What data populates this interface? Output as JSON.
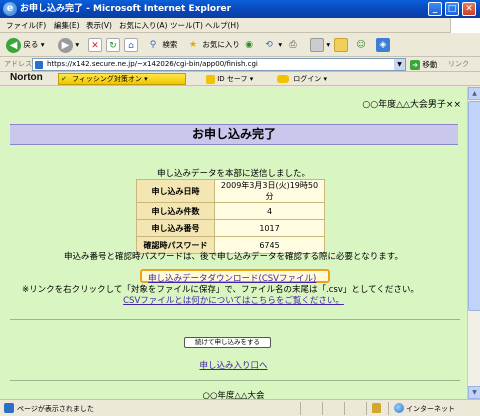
{
  "window": {
    "title": "お申し込み完了 - Microsoft Internet Explorer"
  },
  "menu": [
    "ファイル(F)",
    "編集(E)",
    "表示(V)",
    "お気に入り(A)",
    "ツール(T)",
    "ヘルプ(H)"
  ],
  "toolbar": {
    "back": "戻る",
    "search": "検索",
    "favorites": "お気に入り"
  },
  "address": {
    "label": "アドレス(D)",
    "url": "https://x142.secure.ne.jp/~x142026/cgi-bin/app00/finish.cgi",
    "go": "移動",
    "links": "リンク"
  },
  "norton": {
    "logo": "Norton",
    "phishing": "フィッシング対策オン",
    "idsafe": "ID セーフ",
    "login": "ログイン"
  },
  "page": {
    "event_name": "○○年度△△大会男子××",
    "heading": "お申し込み完了",
    "sent_message": "申し込みデータを本部に送信しました。",
    "table": [
      {
        "key": "申し込み日時",
        "value": "2009年3月3日(火)19時50分"
      },
      {
        "key": "申し込み件数",
        "value": "4"
      },
      {
        "key": "申し込み番号",
        "value": "1017"
      },
      {
        "key": "確認時パスワード",
        "value": "6745"
      }
    ],
    "note1": "申込み番号と確認時パスワードは、後で申し込みデータを確認する際に必要となります。",
    "download_link": "申し込みデータダウンロード(CSVファイル)",
    "note2": "※リンクを右クリックして「対象をファイルに保存」で、ファイル名の末尾は「.csv」としてください。",
    "csv_info_link": "CSVファイルとは何かについてはこちらをご覧ください。",
    "continue_button": "続けて申し込みをする",
    "entry_link": "申し込み入り口へ",
    "footer_name": "○○年度△△大会"
  },
  "status": {
    "text": "ページが表示されました",
    "zone": "インターネット"
  }
}
